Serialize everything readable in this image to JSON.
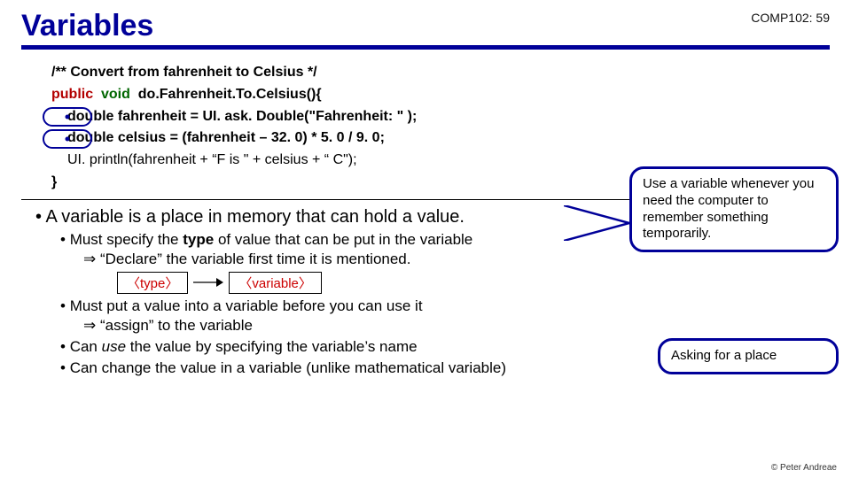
{
  "header": {
    "title": "Variables",
    "course_tag": "COMP102: 59"
  },
  "code": {
    "comment": "/** Convert from fahrenheit to Celsius */",
    "kw_public": "public",
    "kw_void": "void",
    "method_sig": "do.Fahrenheit.To.Celsius(){",
    "line1": "double fahrenheit = UI. ask. Double(\"Fahrenheit: \" );",
    "line2": "double celsius = (fahrenheit – 32. 0) * 5. 0 / 9. 0;",
    "line3": "UI. println(fahrenheit  + “F is \" + celsius + “ C\");",
    "close": "}"
  },
  "callouts": {
    "c1": "Use a variable whenever you need the computer to remember something temporarily.",
    "c2": "Asking for a place"
  },
  "bullets": {
    "b1": "A variable is a place in memory that can hold a value.",
    "b2a": "Must specify the type of value that can be put in the variable",
    "b2a_sub": "⇒ “Declare” the variable first time it is mentioned.",
    "b2b": "Must put a value into a variable before you can use it",
    "b2b_sub": "⇒ “assign” to the variable",
    "b2c": "Can use  the value by specifying the variable’s name",
    "b2d": "Can change the value in a variable  (unlike mathematical variable)"
  },
  "param_labels": {
    "type": "〈type〉",
    "variable": "〈variable〉"
  },
  "footer": "© Peter Andreae"
}
